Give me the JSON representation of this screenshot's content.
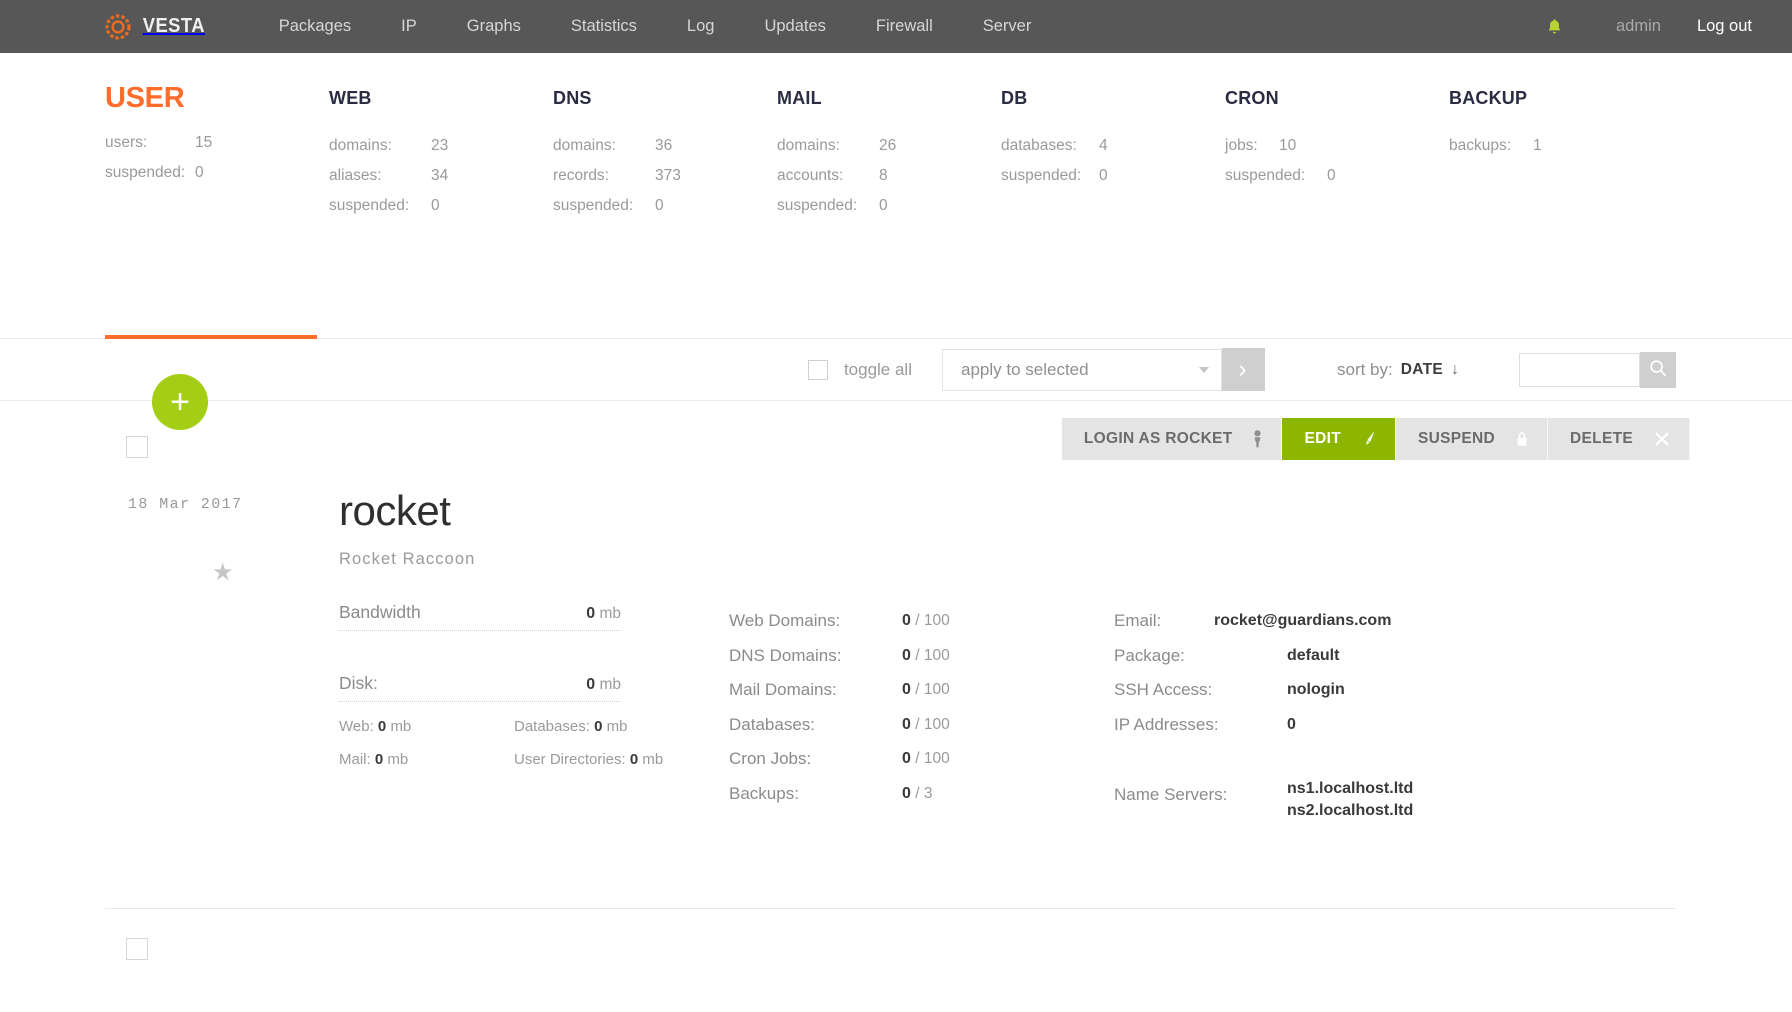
{
  "navbar": {
    "brand": "VESTA",
    "brand_icon": "vesta-ring-icon",
    "links": [
      "Packages",
      "IP",
      "Graphs",
      "Statistics",
      "Log",
      "Updates",
      "Firewall",
      "Server"
    ],
    "bell_icon": "notification-bell-icon",
    "user": "admin",
    "logout": "Log out",
    "bg_color": "#575757",
    "accent_color": "#ff6c2c"
  },
  "stats": {
    "columns": [
      {
        "title": "USER",
        "highlight": true,
        "rows": [
          {
            "key": "users:",
            "value": "15"
          },
          {
            "key": "suspended:",
            "value": "0"
          }
        ]
      },
      {
        "title": "WEB",
        "highlight": false,
        "rows": [
          {
            "key": "domains:",
            "value": "23"
          },
          {
            "key": "aliases:",
            "value": "34"
          },
          {
            "key": "suspended:",
            "value": "0"
          }
        ]
      },
      {
        "title": "DNS",
        "highlight": false,
        "rows": [
          {
            "key": "domains:",
            "value": "36"
          },
          {
            "key": "records:",
            "value": "373"
          },
          {
            "key": "suspended:",
            "value": "0"
          }
        ]
      },
      {
        "title": "MAIL",
        "highlight": false,
        "rows": [
          {
            "key": "domains:",
            "value": "26"
          },
          {
            "key": "accounts:",
            "value": "8"
          },
          {
            "key": "suspended:",
            "value": "0"
          }
        ]
      },
      {
        "title": "DB",
        "highlight": false,
        "rows": [
          {
            "key": "databases:",
            "value": "4"
          },
          {
            "key": "suspended:",
            "value": "0"
          }
        ]
      },
      {
        "title": "CRON",
        "highlight": false,
        "rows": [
          {
            "key": "jobs:",
            "value": "10"
          },
          {
            "key": "suspended:",
            "value": "0"
          }
        ]
      },
      {
        "title": "BACKUP",
        "highlight": false,
        "rows": [
          {
            "key": "backups:",
            "value": "1"
          }
        ]
      }
    ]
  },
  "toolbar": {
    "toggle_all_label": "toggle all",
    "apply_to_selected_label": "apply to selected",
    "go_icon": "chevron-right-icon",
    "sort_by_label": "sort by:",
    "sort_by_value": "DATE",
    "sort_direction_icon": "↓",
    "search_value": "",
    "search_placeholder": "",
    "search_icon": "search-icon"
  },
  "list": {
    "add_button_label": "+",
    "actions": [
      {
        "label": "LOGIN AS ROCKET",
        "icon": "person-icon",
        "primary": false
      },
      {
        "label": "EDIT",
        "icon": "pencil-icon",
        "primary": true
      },
      {
        "label": "SUSPEND",
        "icon": "lock-icon",
        "primary": false
      },
      {
        "label": "DELETE",
        "icon": "close-x-icon",
        "primary": false
      }
    ],
    "accent_green": "#8db600",
    "user": {
      "date": "18 Mar 2017",
      "star_icon": "star-icon",
      "name": "rocket",
      "fullname": "Rocket Raccoon",
      "usage": {
        "bandwidth_label": "Bandwidth",
        "bandwidth_value": "0",
        "bandwidth_unit": "mb",
        "disk_label": "Disk:",
        "disk_value": "0",
        "disk_unit": "mb",
        "sub": [
          {
            "label": "Web:",
            "value": "0",
            "unit": "mb"
          },
          {
            "label": "Databases:",
            "value": "0",
            "unit": "mb"
          },
          {
            "label": "Mail:",
            "value": "0",
            "unit": "mb"
          },
          {
            "label": "User Directories:",
            "value": "0",
            "unit": "mb"
          }
        ]
      },
      "limits": [
        {
          "key": "Web Domains:",
          "used": "0",
          "max": "100"
        },
        {
          "key": "DNS Domains:",
          "used": "0",
          "max": "100"
        },
        {
          "key": "Mail Domains:",
          "used": "0",
          "max": "100"
        },
        {
          "key": "Databases:",
          "used": "0",
          "max": "100"
        },
        {
          "key": "Cron Jobs:",
          "used": "0",
          "max": "100"
        },
        {
          "key": "Backups:",
          "used": "0",
          "max": "3"
        }
      ],
      "info": [
        {
          "key": "Email:",
          "value": "rocket@guardians.com"
        },
        {
          "key": "Package:",
          "value": "default"
        },
        {
          "key": "SSH Access:",
          "value": "nologin"
        },
        {
          "key": "IP Addresses:",
          "value": "0"
        }
      ],
      "nameservers_label": "Name Servers:",
      "nameservers": [
        "ns1.localhost.ltd",
        "ns2.localhost.ltd"
      ]
    }
  }
}
